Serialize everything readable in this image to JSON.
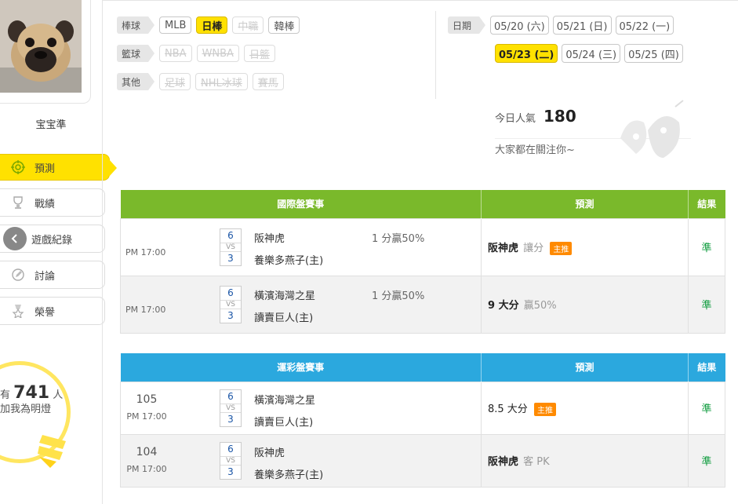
{
  "sidebar": {
    "username": "宝宝準",
    "menu": [
      {
        "label": "預測",
        "icon": "target-icon",
        "active": true
      },
      {
        "label": "戰績",
        "icon": "trophy-icon"
      },
      {
        "label": "遊戲紀錄",
        "icon": "record-icon"
      },
      {
        "label": "討論",
        "icon": "discuss-icon"
      },
      {
        "label": "榮譽",
        "icon": "medal-icon"
      }
    ],
    "followers": {
      "prefix": "有",
      "count": "741",
      "unit": "人",
      "suffix": "加我為明燈"
    }
  },
  "filters": {
    "baseball": {
      "label": "棒球",
      "items": [
        "MLB",
        "日棒",
        "中職",
        "韓棒"
      ]
    },
    "basketball": {
      "label": "籃球",
      "items": [
        "NBA",
        "WNBA",
        "日籃"
      ]
    },
    "other": {
      "label": "其他",
      "items": [
        "足球",
        "NHL冰球",
        "賽馬"
      ]
    }
  },
  "dates": {
    "label": "日期",
    "row1": [
      "05/20 (六)",
      "05/21 (日)",
      "05/22 (一)"
    ],
    "row2": [
      "05/23 (二)",
      "05/24 (三)",
      "05/25 (四)"
    ]
  },
  "popularity": {
    "label": "今日人氣",
    "value": "180",
    "note": "大家都在關注你~"
  },
  "intl_table": {
    "headers": [
      "國際盤賽事",
      "預測",
      "結果"
    ],
    "rows": [
      {
        "time": "PM 17:00",
        "score_a": "6",
        "vs": "VS",
        "score_b": "3",
        "team_a": "阪神虎",
        "team_b": "養樂多燕子(主)",
        "odds": "1 分贏50%",
        "pick": "阪神虎",
        "pick_sub": "讓分",
        "badge": "主推",
        "result": "準"
      },
      {
        "time": "PM 17:00",
        "score_a": "6",
        "vs": "VS",
        "score_b": "3",
        "team_a": "橫濱海灣之星",
        "team_b": "讀賣巨人(主)",
        "odds": "1 分贏50%",
        "pick": "9 大分",
        "pick_sub": "贏50%",
        "badge": "",
        "result": "準"
      }
    ]
  },
  "lottery_table": {
    "headers": [
      "運彩盤賽事",
      "預測",
      "結果"
    ],
    "rows": [
      {
        "code": "105",
        "time": "PM 17:00",
        "score_a": "6",
        "vs": "VS",
        "score_b": "3",
        "team_a": "橫濱海灣之星",
        "team_b": "讀賣巨人(主)",
        "pick": "8.5 大分",
        "pick_sub": "",
        "badge": "主推",
        "result": "準"
      },
      {
        "code": "104",
        "time": "PM 17:00",
        "score_a": "6",
        "vs": "VS",
        "score_b": "3",
        "team_a": "阪神虎",
        "team_b": "養樂多燕子(主)",
        "pick": "阪神虎",
        "pick_sub": "客 PK",
        "badge": "",
        "result": "準"
      }
    ]
  }
}
